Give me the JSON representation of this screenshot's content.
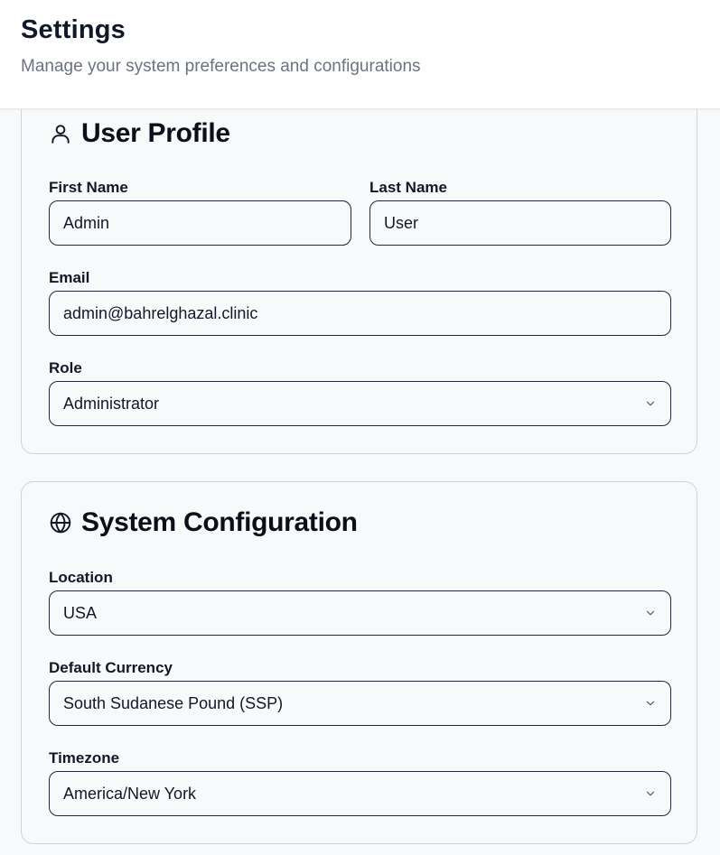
{
  "header": {
    "title": "Settings",
    "subtitle": "Manage your system preferences and configurations"
  },
  "user_profile": {
    "title": "User Profile",
    "icon": "user-icon",
    "first_name": {
      "label": "First Name",
      "value": "Admin"
    },
    "last_name": {
      "label": "Last Name",
      "value": "User"
    },
    "email": {
      "label": "Email",
      "value": "admin@bahrelghazal.clinic"
    },
    "role": {
      "label": "Role",
      "value": "Administrator"
    }
  },
  "system_configuration": {
    "title": "System Configuration",
    "icon": "globe-icon",
    "location": {
      "label": "Location",
      "value": "USA"
    },
    "currency": {
      "label": "Default Currency",
      "value": "South Sudanese Pound (SSP)"
    },
    "timezone": {
      "label": "Timezone",
      "value": "America/New York"
    }
  }
}
